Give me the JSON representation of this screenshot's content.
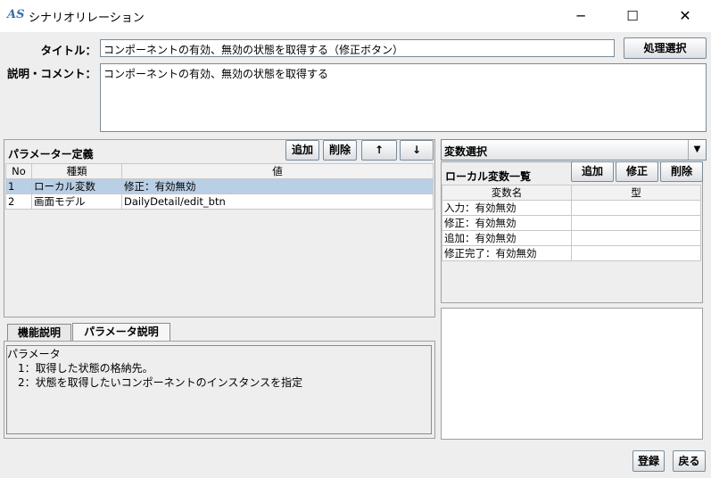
{
  "window": {
    "app_icon": "AS",
    "title": "シナリオリレーション",
    "min": "─",
    "max": "☐",
    "close": "✕"
  },
  "header": {
    "title_label": "タイトル：",
    "title_value": "コンポーネントの有効、無効の状態を取得する（修正ボタン）",
    "process_select": "処理選択",
    "desc_label": "説明・コメント：",
    "desc_value": "コンポーネントの有効、無効の状態を取得する"
  },
  "params": {
    "title": "パラメーター定義",
    "add": "追加",
    "del": "削除",
    "up": "↑",
    "down": "↓",
    "columns": [
      "No",
      "種類",
      "値"
    ],
    "rows": [
      {
        "no": "1",
        "kind": "ローカル変数",
        "value": "修正：有効無効"
      },
      {
        "no": "2",
        "kind": "画面モデル",
        "value": "DailyDetail/edit_btn"
      }
    ]
  },
  "tabs": {
    "items": [
      "機能説明",
      "パラメータ説明"
    ],
    "active": 1,
    "content": [
      "パラメータ",
      "　1：取得した状態の格納先。",
      "　2：状態を取得したいコンポーネントのインスタンスを指定"
    ]
  },
  "vars": {
    "select_value": "変数選択",
    "list_title": "ローカル変数一覧",
    "add": "追加",
    "edit": "修正",
    "del": "削除",
    "columns": [
      "変数名",
      "型"
    ],
    "rows": [
      {
        "name": "入力：有効無効",
        "type": ""
      },
      {
        "name": "修正：有効無効",
        "type": ""
      },
      {
        "name": "追加：有効無効",
        "type": ""
      },
      {
        "name": "修正完了：有効無効",
        "type": ""
      }
    ]
  },
  "footer": {
    "register": "登録",
    "back": "戻る"
  },
  "icons": {
    "dropdown": "chevron-down-icon",
    "app": "as-logo-icon"
  }
}
